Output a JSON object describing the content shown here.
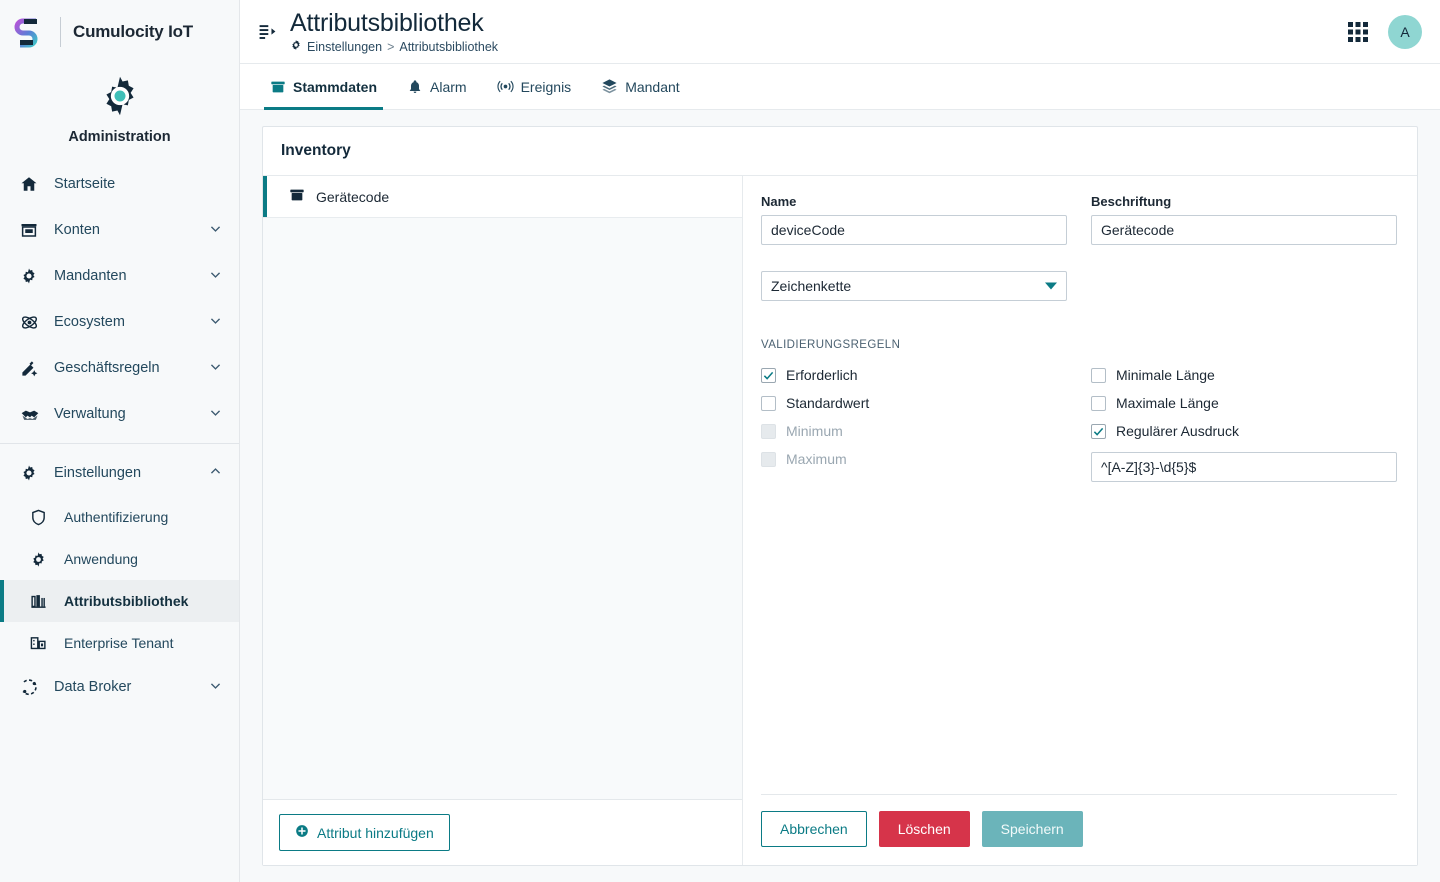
{
  "brand": {
    "name": "Cumulocity IoT",
    "logo_icon": "cumulocity-logo",
    "app_icon": "gear-icon",
    "app_title": "Administration"
  },
  "sidebar": {
    "items": [
      {
        "label": "Startseite",
        "icon": "home-icon",
        "expandable": false
      },
      {
        "label": "Konten",
        "icon": "accounts-icon",
        "expandable": true
      },
      {
        "label": "Mandanten",
        "icon": "gear-icon",
        "expandable": true
      },
      {
        "label": "Ecosystem",
        "icon": "atom-icon",
        "expandable": true
      },
      {
        "label": "Geschäftsregeln",
        "icon": "rules-icon",
        "expandable": true
      },
      {
        "label": "Verwaltung",
        "icon": "handshake-icon",
        "expandable": true
      }
    ],
    "settings": {
      "label": "Einstellungen",
      "icon": "gear-icon",
      "expanded": true,
      "children": [
        {
          "label": "Authentifizierung",
          "icon": "shield-icon",
          "active": false
        },
        {
          "label": "Anwendung",
          "icon": "gear-icon",
          "active": false
        },
        {
          "label": "Attributsbibliothek",
          "icon": "library-icon",
          "active": true
        },
        {
          "label": "Enterprise Tenant",
          "icon": "enterprise-icon",
          "active": false
        }
      ]
    },
    "data_broker": {
      "label": "Data Broker",
      "icon": "broker-icon",
      "expandable": true
    }
  },
  "header": {
    "collapse_icon": "navigator-collapse-icon",
    "title": "Attributsbibliothek",
    "breadcrumb": {
      "icon": "gear-icon",
      "root": "Einstellungen",
      "separator": ">",
      "current": "Attributsbibliothek"
    },
    "app_switcher_icon": "grid-icon",
    "avatar_initial": "A",
    "avatar_color": "#8fd6d2"
  },
  "tabs": [
    {
      "label": "Stammdaten",
      "icon": "archive-box-icon",
      "active": true
    },
    {
      "label": "Alarm",
      "icon": "bell-icon",
      "active": false
    },
    {
      "label": "Ereignis",
      "icon": "broadcast-icon",
      "active": false
    },
    {
      "label": "Mandant",
      "icon": "layers-icon",
      "active": false
    }
  ],
  "card": {
    "title": "Inventory"
  },
  "list_panel": {
    "items": [
      {
        "label": "Gerätecode",
        "icon": "archive-box-icon",
        "selected": true
      }
    ],
    "add_button": {
      "label": "Attribut hinzufügen",
      "icon": "plus-circle-icon"
    }
  },
  "form": {
    "name": {
      "label": "Name",
      "value": "deviceCode"
    },
    "beschriftung": {
      "label": "Beschriftung",
      "value": "Gerätecode"
    },
    "type_select": {
      "value": "Zeichenkette"
    },
    "validation": {
      "section_label": "VALIDIERUNGSREGELN",
      "left": [
        {
          "label": "Erforderlich",
          "checked": true,
          "disabled": false
        },
        {
          "label": "Standardwert",
          "checked": false,
          "disabled": false
        },
        {
          "label": "Minimum",
          "checked": false,
          "disabled": true
        },
        {
          "label": "Maximum",
          "checked": false,
          "disabled": true
        }
      ],
      "right": [
        {
          "label": "Minimale Länge",
          "checked": false,
          "disabled": false
        },
        {
          "label": "Maximale Länge",
          "checked": false,
          "disabled": false
        },
        {
          "label": "Regulärer Ausdruck",
          "checked": true,
          "disabled": false
        }
      ],
      "regex_value": "^[A-Z]{3}-\\d{5}$"
    },
    "buttons": {
      "cancel": "Abbrechen",
      "delete": "Löschen",
      "save": "Speichern"
    }
  },
  "colors": {
    "accent_teal": "#0b7b85",
    "danger_red": "#d6344a",
    "save_disabled": "#6bb4ba",
    "navy": "#13293a"
  }
}
